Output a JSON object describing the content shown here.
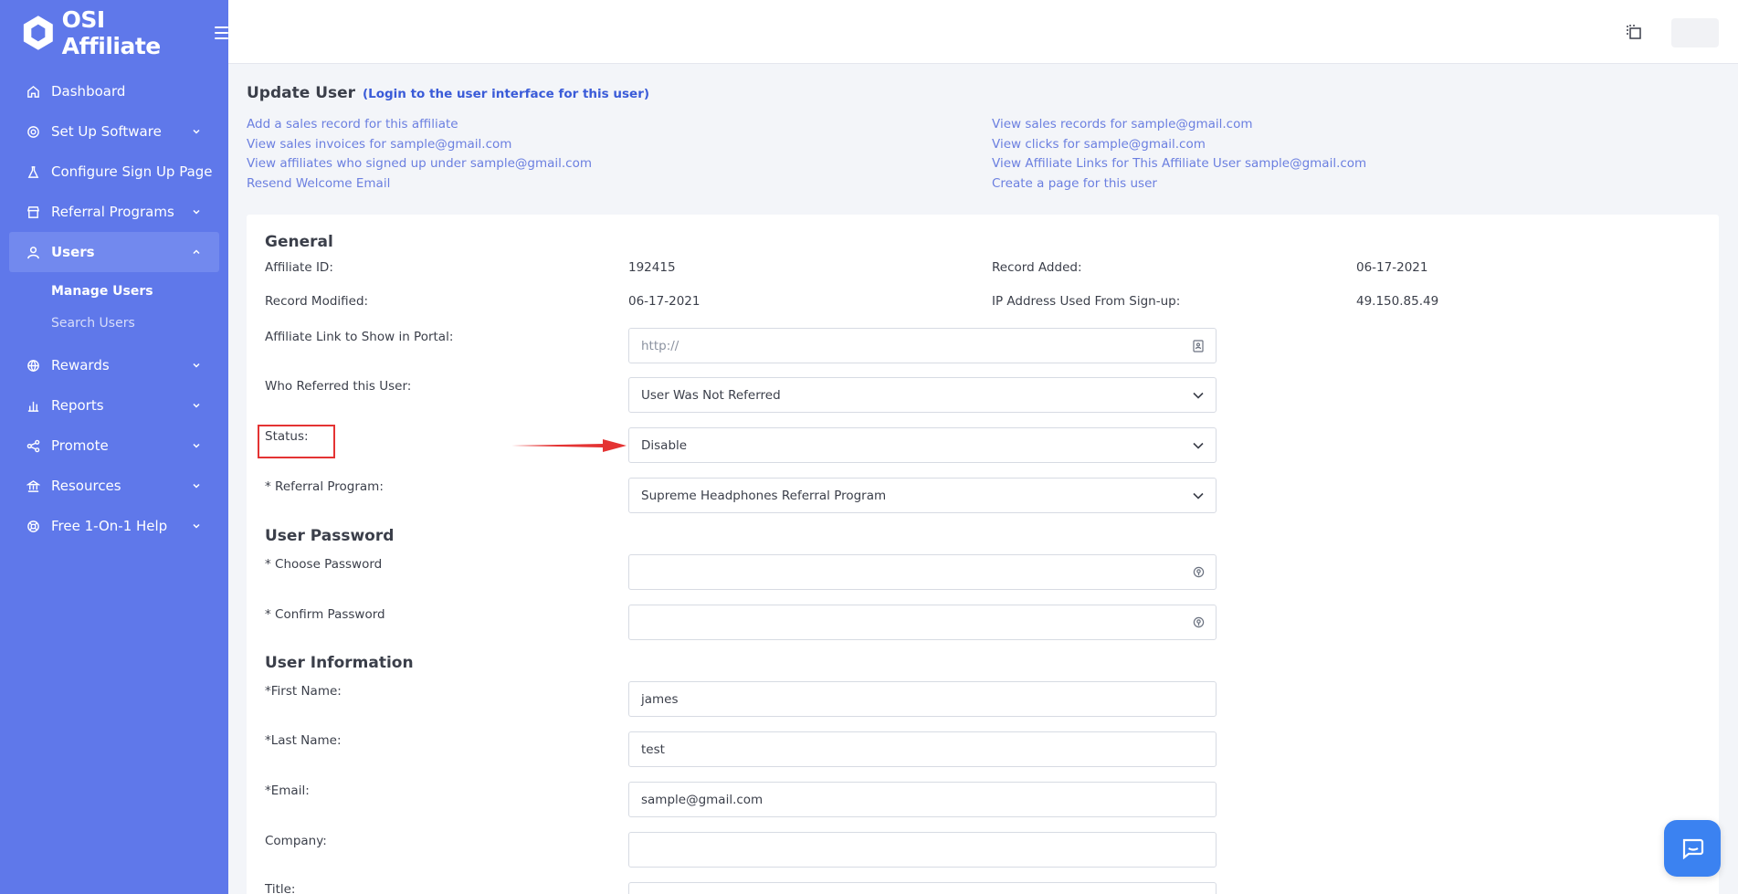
{
  "brand": {
    "name": "OSI Affiliate"
  },
  "sidebar": {
    "items": [
      {
        "label": "Dashboard",
        "icon": "home-icon"
      },
      {
        "label": "Set Up Software",
        "icon": "gear-icon",
        "expandable": true
      },
      {
        "label": "Configure Sign Up Page",
        "icon": "flask-icon"
      },
      {
        "label": "Referral Programs",
        "icon": "store-icon",
        "expandable": true
      },
      {
        "label": "Users",
        "icon": "user-icon",
        "expandable": true,
        "expanded": true
      },
      {
        "label": "Rewards",
        "icon": "globe-icon",
        "expandable": true
      },
      {
        "label": "Reports",
        "icon": "bar-chart-icon",
        "expandable": true
      },
      {
        "label": "Promote",
        "icon": "share-icon",
        "expandable": true
      },
      {
        "label": "Resources",
        "icon": "bank-icon",
        "expandable": true
      },
      {
        "label": "Free 1-On-1 Help",
        "icon": "lifebuoy-icon",
        "expandable": true
      }
    ],
    "users_sub": [
      "Manage Users",
      "Search Users"
    ]
  },
  "page": {
    "title": "Update User",
    "login_link": "(Login to the user interface for this user)",
    "links_left": [
      "Add a sales record for this affiliate",
      "View sales invoices for sample@gmail.com",
      "View affiliates who signed up under sample@gmail.com",
      "Resend Welcome Email"
    ],
    "links_right": [
      "View sales records for sample@gmail.com",
      "View clicks for sample@gmail.com",
      "View Affiliate Links for This Affiliate User sample@gmail.com",
      "Create a page for this user"
    ]
  },
  "general": {
    "title": "General",
    "affiliate_id_label": "Affiliate ID:",
    "affiliate_id": "192415",
    "record_added_label": "Record Added:",
    "record_added": "06-17-2021",
    "record_modified_label": "Record Modified:",
    "record_modified": "06-17-2021",
    "ip_label": "IP Address Used From Sign-up:",
    "ip": "49.150.85.49",
    "link_label": "Affiliate Link to Show in Portal:",
    "link_placeholder": "http://",
    "referred_label": "Who Referred this User:",
    "referred_value": "User Was Not Referred",
    "status_label": "Status:",
    "status_value": "Disable",
    "program_label": "* Referral Program:",
    "program_value": "Supreme Headphones Referral Program"
  },
  "password": {
    "title": "User Password",
    "choose_label": "* Choose Password",
    "confirm_label": "* Confirm Password"
  },
  "info": {
    "title": "User Information",
    "first_name_label": "*First Name:",
    "first_name": "james",
    "last_name_label": "*Last Name:",
    "last_name": "test",
    "email_label": "*Email:",
    "email": "sample@gmail.com",
    "company_label": "Company:",
    "company": "",
    "title_label": "Title:"
  },
  "colors": {
    "sidebar_bg": "#5f78ea",
    "link": "#6b7fe0",
    "annotation": "#e43333",
    "chat": "#3b82f1"
  }
}
